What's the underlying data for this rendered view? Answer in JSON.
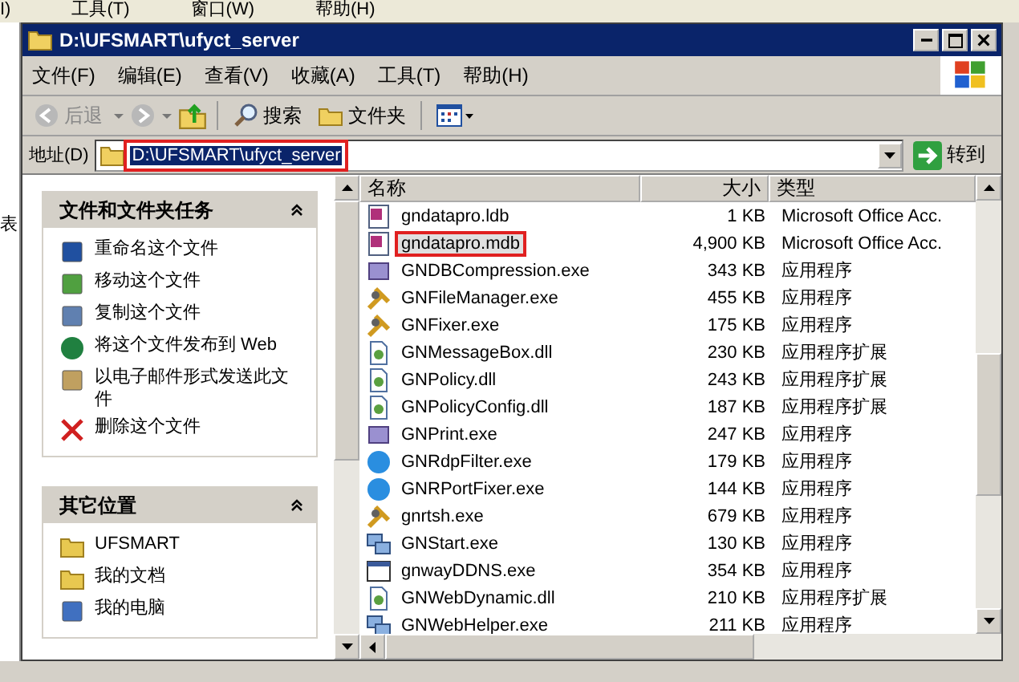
{
  "background_app": {
    "menu": [
      "I)",
      "工具(T)",
      "窗口(W)",
      "帮助(H)"
    ],
    "side_text": "表"
  },
  "window": {
    "title": "D:\\UFSMART\\ufyct_server"
  },
  "menu": [
    "文件(F)",
    "编辑(E)",
    "查看(V)",
    "收藏(A)",
    "工具(T)",
    "帮助(H)"
  ],
  "toolbar": {
    "back": "后退",
    "search": "搜索",
    "folders": "文件夹"
  },
  "address": {
    "label": "地址(D)",
    "value": "D:\\UFSMART\\ufyct_server",
    "highlighted": true,
    "go": "转到"
  },
  "tasks": {
    "title": "文件和文件夹任务",
    "expanded": true,
    "items": [
      {
        "label": "重命名这个文件",
        "kind": "rename"
      },
      {
        "label": "移动这个文件",
        "kind": "move"
      },
      {
        "label": "复制这个文件",
        "kind": "copy"
      },
      {
        "label": "将这个文件发布到 Web",
        "kind": "web"
      },
      {
        "label": "以电子邮件形式发送此文件",
        "kind": "mail"
      },
      {
        "label": "删除这个文件",
        "kind": "delete"
      }
    ]
  },
  "places": {
    "title": "其它位置",
    "expanded": true,
    "items": [
      {
        "label": "UFSMART",
        "kind": "folder"
      },
      {
        "label": "我的文档",
        "kind": "docs"
      },
      {
        "label": "我的电脑",
        "kind": "computer"
      }
    ]
  },
  "list": {
    "columns": [
      "名称",
      "大小",
      "类型"
    ],
    "rows": [
      {
        "name": "gndatapro.ldb",
        "size": "1 KB",
        "type": "Microsoft Office Acc.",
        "kind": "access",
        "selected": false,
        "highlighted": false
      },
      {
        "name": "gndatapro.mdb",
        "size": "4,900 KB",
        "type": "Microsoft Office Acc.",
        "kind": "access",
        "selected": true,
        "highlighted": true
      },
      {
        "name": "GNDBCompression.exe",
        "size": "343 KB",
        "type": "应用程序",
        "kind": "exe",
        "selected": false,
        "highlighted": false
      },
      {
        "name": "GNFileManager.exe",
        "size": "455 KB",
        "type": "应用程序",
        "kind": "tool",
        "selected": false,
        "highlighted": false
      },
      {
        "name": "GNFixer.exe",
        "size": "175 KB",
        "type": "应用程序",
        "kind": "tool",
        "selected": false,
        "highlighted": false
      },
      {
        "name": "GNMessageBox.dll",
        "size": "230 KB",
        "type": "应用程序扩展",
        "kind": "dll",
        "selected": false,
        "highlighted": false
      },
      {
        "name": "GNPolicy.dll",
        "size": "243 KB",
        "type": "应用程序扩展",
        "kind": "dll",
        "selected": false,
        "highlighted": false
      },
      {
        "name": "GNPolicyConfig.dll",
        "size": "187 KB",
        "type": "应用程序扩展",
        "kind": "dll",
        "selected": false,
        "highlighted": false
      },
      {
        "name": "GNPrint.exe",
        "size": "247 KB",
        "type": "应用程序",
        "kind": "exe",
        "selected": false,
        "highlighted": false
      },
      {
        "name": "GNRdpFilter.exe",
        "size": "179 KB",
        "type": "应用程序",
        "kind": "globe",
        "selected": false,
        "highlighted": false
      },
      {
        "name": "GNRPortFixer.exe",
        "size": "144 KB",
        "type": "应用程序",
        "kind": "globe",
        "selected": false,
        "highlighted": false
      },
      {
        "name": "gnrtsh.exe",
        "size": "679 KB",
        "type": "应用程序",
        "kind": "tool",
        "selected": false,
        "highlighted": false
      },
      {
        "name": "GNStart.exe",
        "size": "130 KB",
        "type": "应用程序",
        "kind": "network",
        "selected": false,
        "highlighted": false
      },
      {
        "name": "gnwayDDNS.exe",
        "size": "354 KB",
        "type": "应用程序",
        "kind": "window",
        "selected": false,
        "highlighted": false
      },
      {
        "name": "GNWebDynamic.dll",
        "size": "210 KB",
        "type": "应用程序扩展",
        "kind": "dll",
        "selected": false,
        "highlighted": false
      },
      {
        "name": "GNWebHelper.exe",
        "size": "211 KB",
        "type": "应用程序",
        "kind": "network",
        "selected": false,
        "highlighted": false
      }
    ]
  }
}
